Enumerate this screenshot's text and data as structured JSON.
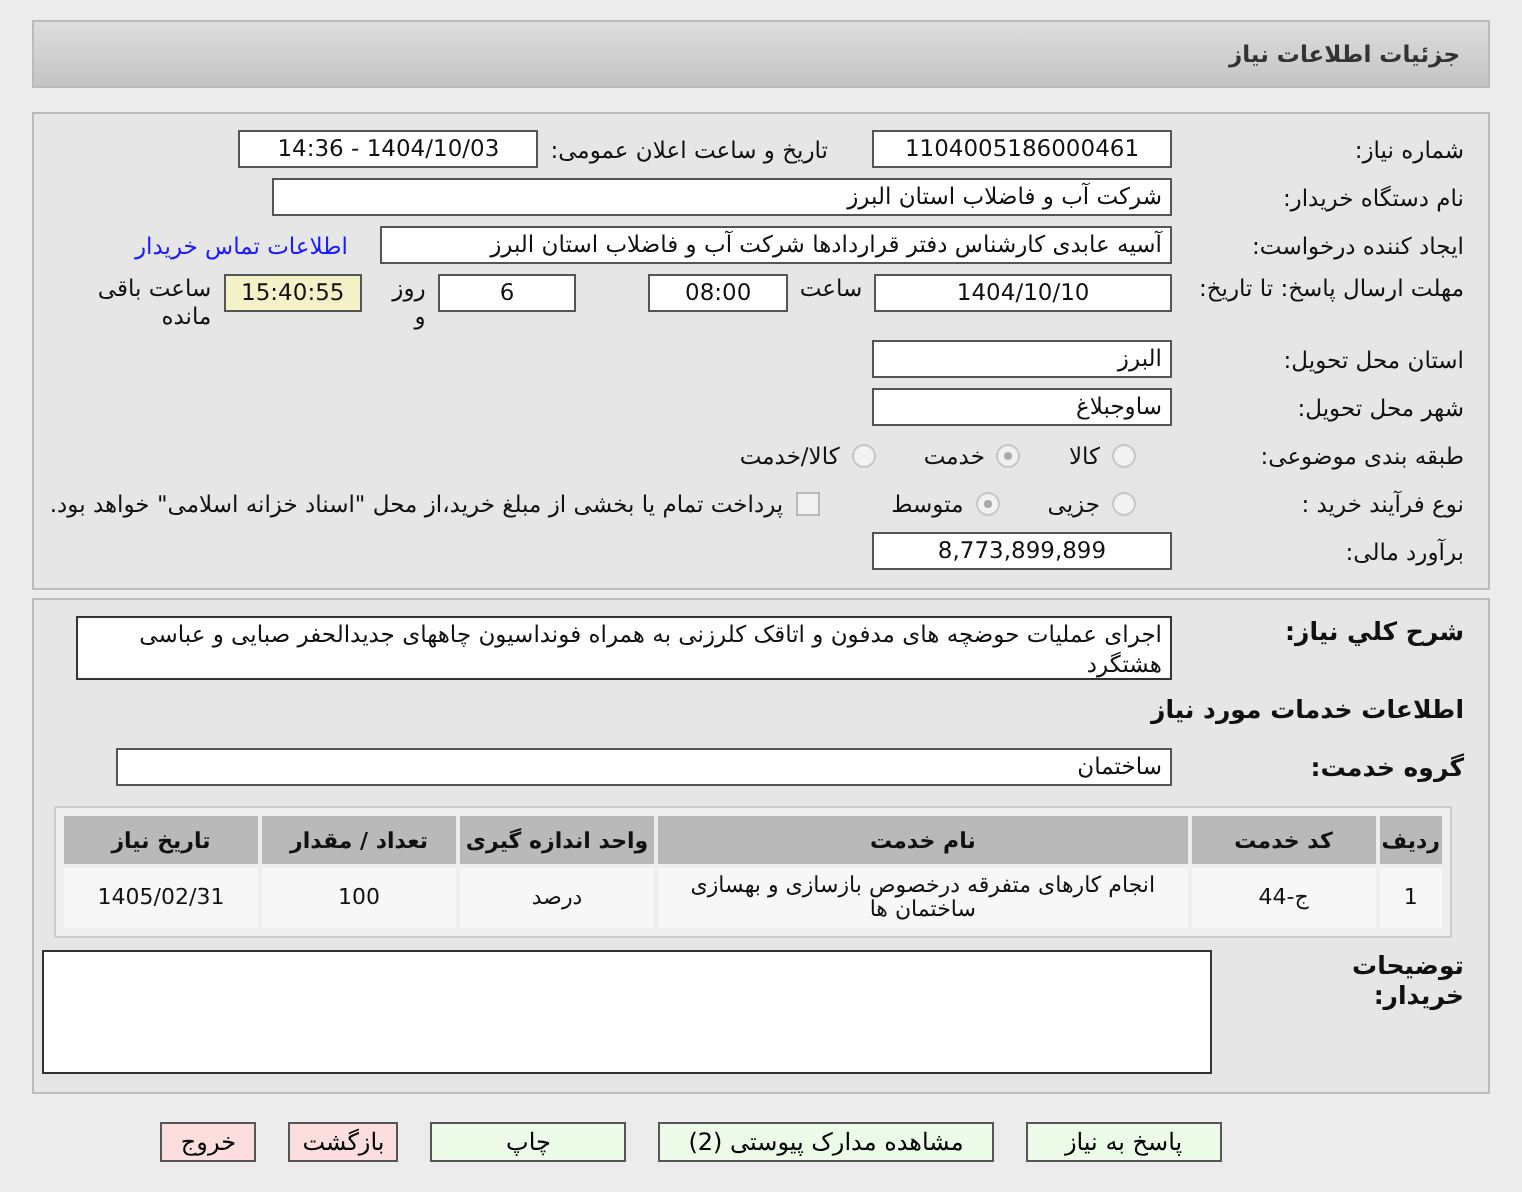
{
  "header": {
    "title": "جزئیات اطلاعات نیاز"
  },
  "need_number": {
    "label": "شماره نیاز:",
    "value": "1104005186000461"
  },
  "announce": {
    "label": "تاریخ و ساعت اعلان عمومی:",
    "value": "1404/10/03 - 14:36"
  },
  "buyer": {
    "label": "نام دستگاه خریدار:",
    "value": "شرکت آب و فاضلاب استان البرز"
  },
  "creator": {
    "label": "ایجاد کننده درخواست:",
    "value": "آسیه عابدی کارشناس دفتر قراردادها شرکت آب و فاضلاب استان البرز",
    "link": "اطلاعات تماس خریدار"
  },
  "deadline": {
    "label": "مهلت ارسال پاسخ: تا تاریخ:",
    "date": "1404/10/10",
    "time_label": "ساعت",
    "time": "08:00",
    "days": "6",
    "days_label": "روز و",
    "remaining": "15:40:55",
    "remaining_label": "ساعت باقی مانده"
  },
  "province": {
    "label": "استان محل تحویل:",
    "value": "البرز"
  },
  "city": {
    "label": "شهر محل تحویل:",
    "value": "ساوجبلاغ"
  },
  "category": {
    "label": "طبقه بندی موضوعی:",
    "options": [
      {
        "label": "کالا",
        "selected": false
      },
      {
        "label": "خدمت",
        "selected": true
      },
      {
        "label": "کالا/خدمت",
        "selected": false
      }
    ]
  },
  "process": {
    "label": "نوع فرآیند خرید :",
    "options": [
      {
        "label": "جزیی",
        "selected": false
      },
      {
        "label": "متوسط",
        "selected": true
      }
    ],
    "payment": {
      "checked": false,
      "text": "پرداخت تمام یا بخشی از مبلغ خرید،از محل \"اسناد خزانه اسلامی\" خواهد بود."
    }
  },
  "budget": {
    "label": "برآورد مالی:",
    "value": "8,773,899,899"
  },
  "description": {
    "label": "شرح کلي نياز:",
    "value": "اجرای عملیات حوضچه های مدفون و اتاقک کلرزنی به همراه فونداسیون چاههای جدیدالحفر صبایی و عباسی هشتگرد"
  },
  "services_heading": "اطلاعات خدمات مورد نیاز",
  "service_group": {
    "label": "گروه خدمت:",
    "value": "ساختمان"
  },
  "table": {
    "columns": [
      "ردیف",
      "کد خدمت",
      "نام خدمت",
      "واحد اندازه گیری",
      "تعداد / مقدار",
      "تاریخ نیاز"
    ],
    "rows": [
      [
        "1",
        "ج-44",
        "انجام کارهای متفرقه درخصوص بازسازی و بهسازی ساختمان ها",
        "درصد",
        "100",
        "1405/02/31"
      ]
    ]
  },
  "notes": {
    "label": "توضیحات خریدار:"
  },
  "buttons": [
    {
      "label": "پاسخ به نیاز",
      "kind": "action"
    },
    {
      "label": "مشاهده مدارک پیوستی (2)",
      "kind": "action"
    },
    {
      "label": "چاپ",
      "kind": "action"
    },
    {
      "label": "بازگشت",
      "kind": "exit"
    },
    {
      "label": "خروج",
      "kind": "exit"
    }
  ]
}
